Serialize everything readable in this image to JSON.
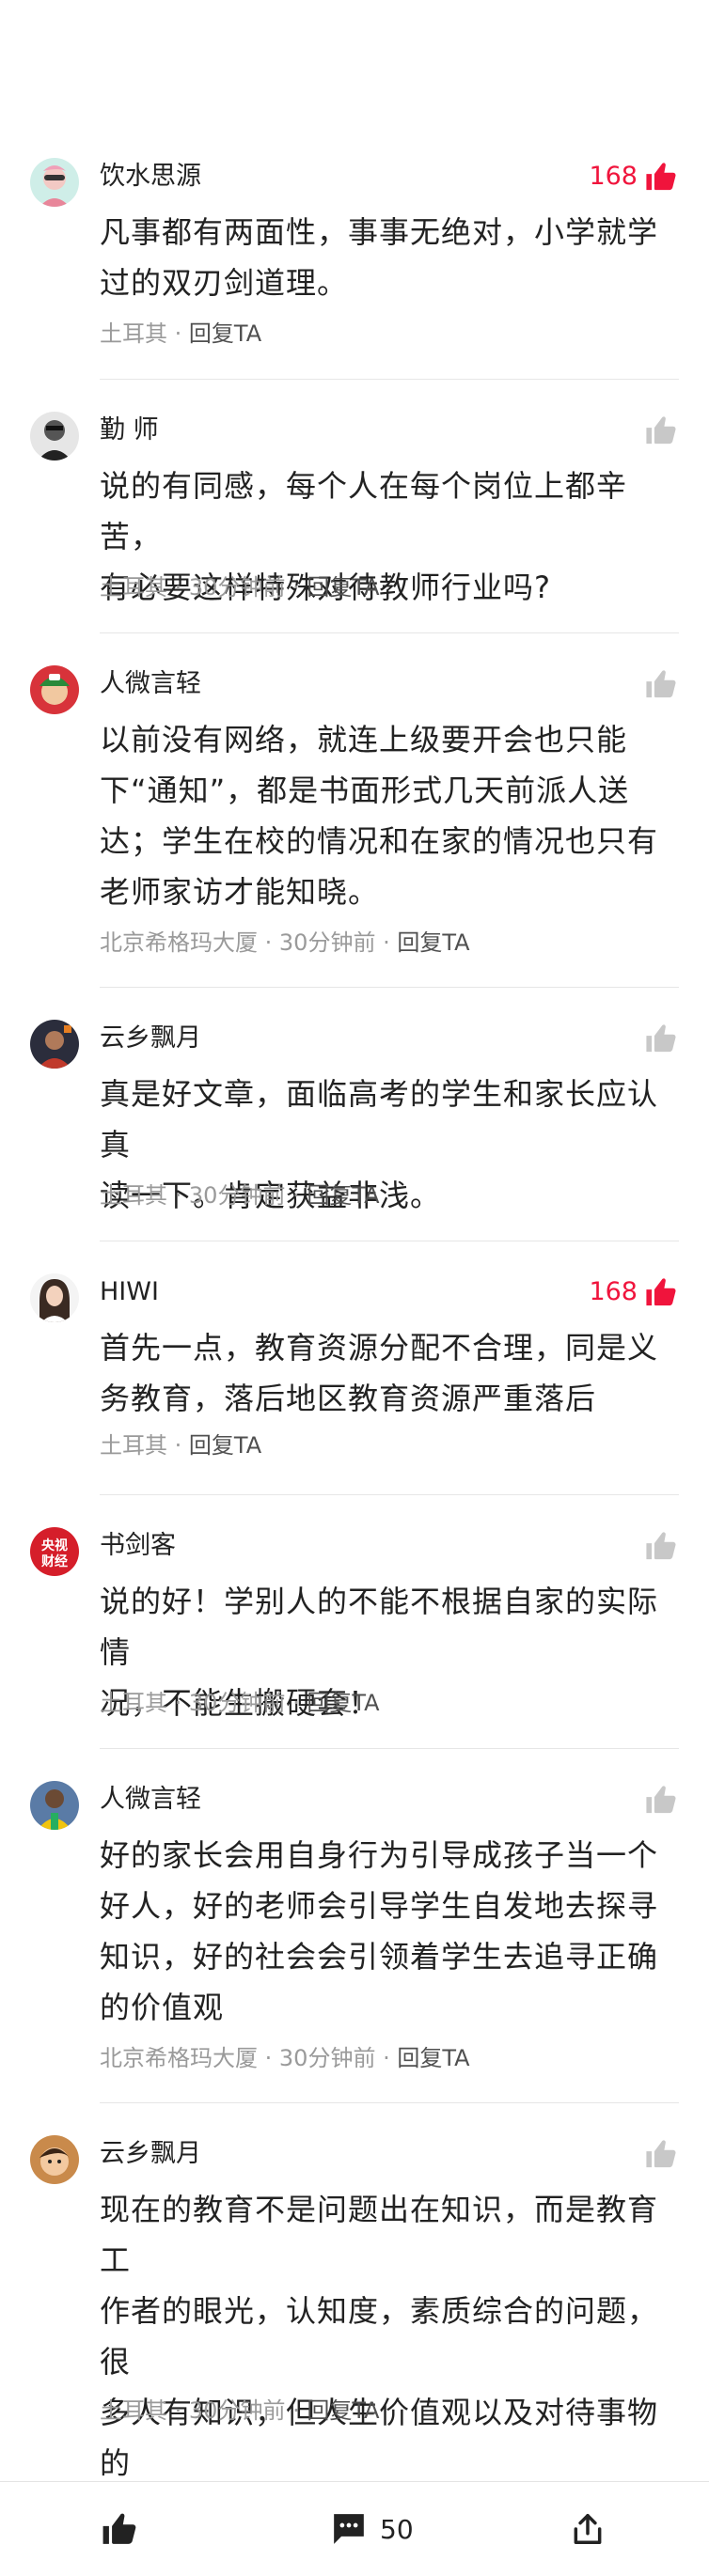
{
  "comments": [
    {
      "author": "饮水思源",
      "avatar": "avatar-pink-sunglasses",
      "likes": "168",
      "liked": true,
      "text": "凡事都有两面性，事事无绝对，小学就学\n过的双刃剑道理。",
      "location": "土耳其",
      "time": "",
      "reply": "回复TA"
    },
    {
      "author": "勤 师",
      "avatar": "avatar-bw-person",
      "likes": "",
      "liked": false,
      "text": "说的有同感，每个人在每个岗位上都辛苦，\n有必要这样特殊对待教师行业吗?",
      "location": "土耳其",
      "time": "30分钟前",
      "reply": "回复TA"
    },
    {
      "author": "人微言轻",
      "avatar": "avatar-green-cap",
      "likes": "",
      "liked": false,
      "text": "以前没有网络，就连上级要开会也只能\n下“通知”，都是书面形式几天前派人送\n达；学生在校的情况和在家的情况也只有\n老师家访才能知晓。",
      "location": "北京希格玛大厦",
      "time": "30分钟前",
      "reply": "回复TA"
    },
    {
      "author": "云乡飘月",
      "avatar": "avatar-dark-sports",
      "likes": "",
      "liked": false,
      "text": "真是好文章，面临高考的学生和家长应认真\n读一下。肯定获益非浅。",
      "location": "土耳其",
      "time": "30分钟前",
      "reply": "回复TA"
    },
    {
      "author": "HIWI",
      "avatar": "avatar-woman",
      "likes": "168",
      "liked": true,
      "text": "首先一点，教育资源分配不合理，同是义\n务教育，落后地区教育资源严重落后",
      "location": "土耳其",
      "time": "",
      "reply": "回复TA"
    },
    {
      "author": "书剑客",
      "avatar": "avatar-cctv-finance",
      "avatar_text": [
        "央视",
        "财经"
      ],
      "likes": "",
      "liked": false,
      "text": "说的好！学别人的不能不根据自家的实际情\n况，不能生搬硬套！",
      "location": "土耳其",
      "time": "30分钟前",
      "reply": "回复TA"
    },
    {
      "author": "人微言轻",
      "avatar": "avatar-football-player",
      "likes": "",
      "liked": false,
      "text": "好的家长会用自身行为引导成孩子当一个\n好人，好的老师会引导学生自发地去探寻\n知识，好的社会会引领着学生去追寻正确\n的价值观",
      "location": "北京希格玛大厦",
      "time": "30分钟前",
      "reply": "回复TA"
    },
    {
      "author": "云乡飘月",
      "avatar": "avatar-child",
      "likes": "",
      "liked": false,
      "text": "现在的教育不是问题出在知识，而是教育工\n作者的眼光，认知度，素质综合的问题，很\n多人有知识，但人生价值观以及对待事物的\n正确处置性极度缺乏，这才是最关键问题",
      "location": "土耳其",
      "time": "30分钟前",
      "reply": "回复TA"
    }
  ],
  "bottom_bar": {
    "like_icon": "thumbs-up-icon",
    "comment_icon": "comment-bubble-icon",
    "comment_count": "50",
    "share_icon": "share-icon"
  },
  "colors": {
    "like_active": "#f0143c",
    "like_inactive": "#c8c8c8",
    "meta_text": "#9a9a9a",
    "body_text": "#222222"
  }
}
